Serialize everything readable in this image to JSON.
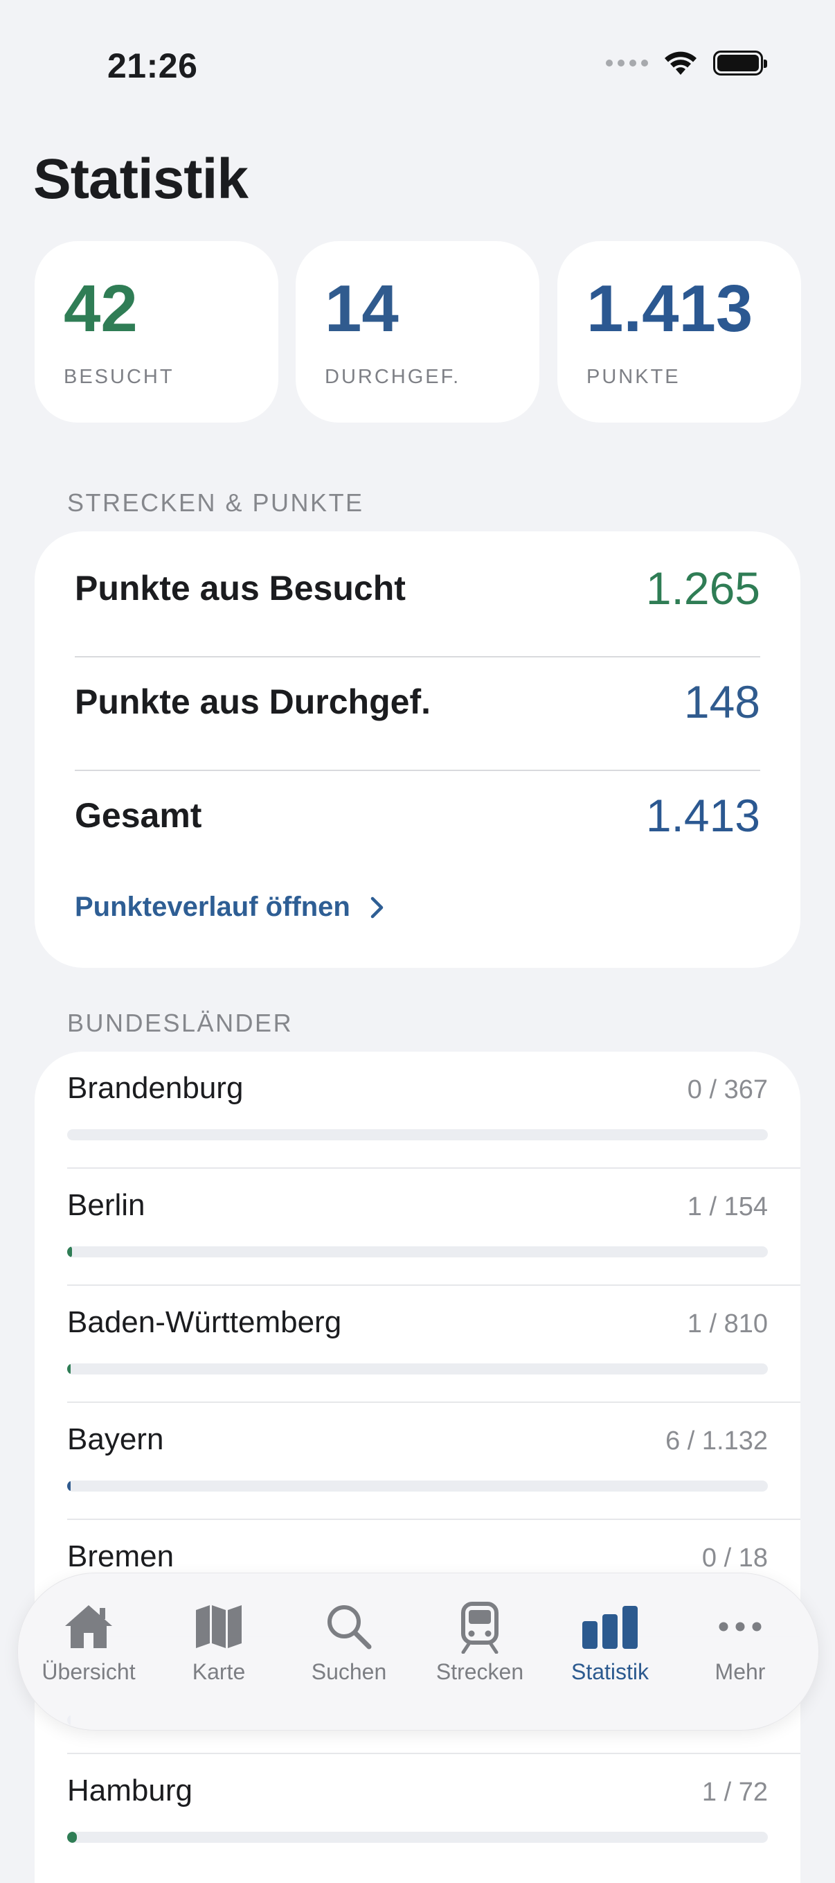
{
  "status_bar": {
    "time": "21:26"
  },
  "title": "Statistik",
  "stats": [
    {
      "value": "42",
      "label": "BESUCHT",
      "color": "#2f7d55"
    },
    {
      "value": "14",
      "label": "DURCHGEF.",
      "color": "#305b8e"
    },
    {
      "value": "1.413",
      "label": "PUNKTE",
      "color": "#2b5891"
    }
  ],
  "points_section": {
    "header": "STRECKEN & PUNKTE",
    "rows": [
      {
        "label": "Punkte aus Besucht",
        "value": "1.265",
        "color": "#2f7d55"
      },
      {
        "label": "Punkte aus Durchgef.",
        "value": "148",
        "color": "#305b8e"
      },
      {
        "label": "Gesamt",
        "value": "1.413",
        "color": "#2b5891"
      }
    ],
    "link": "Punkteverlauf öffnen"
  },
  "states_section": {
    "header": "BUNDESLÄNDER",
    "states": [
      {
        "name": "Brandenburg",
        "count": "0 / 367",
        "progress": 0.0,
        "color": "#2f7d55"
      },
      {
        "name": "Berlin",
        "count": "1 / 154",
        "progress": 0.0065,
        "color": "#2f7d55"
      },
      {
        "name": "Baden-Württemberg",
        "count": "1 / 810",
        "progress": 0.0012,
        "color": "#2f7d55"
      },
      {
        "name": "Bayern",
        "count": "6 / 1.132",
        "progress": 0.0053,
        "color": "#305b8e"
      },
      {
        "name": "Bremen",
        "count": "0 / 18",
        "progress": 0.0,
        "color": "#2f7d55"
      },
      {
        "name": "",
        "count": "",
        "progress": 0.003,
        "color": "#305b8e"
      },
      {
        "name": "Hamburg",
        "count": "1 / 72",
        "progress": 0.014,
        "color": "#2f7d55"
      }
    ]
  },
  "tabbar": {
    "tabs": [
      {
        "label": "Übersicht",
        "icon": "house-icon",
        "active": false
      },
      {
        "label": "Karte",
        "icon": "map-icon",
        "active": false
      },
      {
        "label": "Suchen",
        "icon": "magnifier-icon",
        "active": false
      },
      {
        "label": "Strecken",
        "icon": "tram-icon",
        "active": false
      },
      {
        "label": "Statistik",
        "icon": "chart-bar-icon",
        "active": true
      },
      {
        "label": "Mehr",
        "icon": "ellipsis-icon",
        "active": false
      }
    ]
  }
}
